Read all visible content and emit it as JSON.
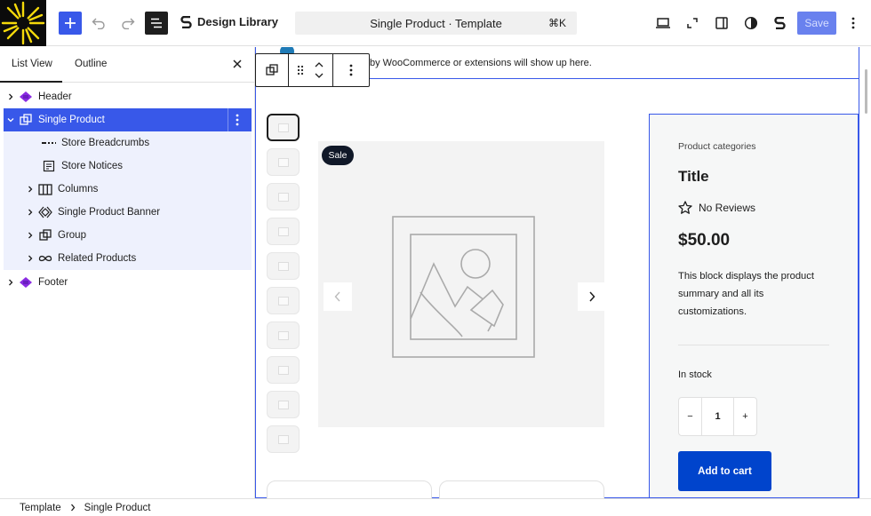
{
  "topbar": {
    "brand_label": "Design Library",
    "command_title": "Single Product · Template",
    "command_shortcut": "⌘K",
    "save_label": "Save"
  },
  "sidebar": {
    "tabs": [
      "List View",
      "Outline"
    ],
    "items": [
      {
        "label": "Header",
        "icon": "template-part-icon"
      },
      {
        "label": "Single Product",
        "icon": "group-icon"
      },
      {
        "label": "Store Breadcrumbs",
        "icon": "breadcrumbs-icon"
      },
      {
        "label": "Store Notices",
        "icon": "notices-icon"
      },
      {
        "label": "Columns",
        "icon": "columns-icon"
      },
      {
        "label": "Single Product Banner",
        "icon": "pattern-icon"
      },
      {
        "label": "Group",
        "icon": "group-icon"
      },
      {
        "label": "Related Products",
        "icon": "loop-icon"
      },
      {
        "label": "Footer",
        "icon": "template-part-icon"
      }
    ]
  },
  "canvas": {
    "notice_text": "by WooCommerce or extensions will show up here.",
    "sale_badge": "Sale",
    "product": {
      "category": "Product categories",
      "title": "Title",
      "reviews": "No Reviews",
      "price": "$50.00",
      "description": "This block displays the product summary and all its customizations.",
      "stock": "In stock",
      "quantity": "1",
      "qty_minus": "−",
      "qty_plus": "+",
      "cart_label": "Add to cart"
    }
  },
  "breadcrumb": [
    "Template",
    "Single Product"
  ],
  "colors": {
    "accent": "#3858e9",
    "cart_button": "#0044cc",
    "sale_badge": "#101828",
    "logo": "#f5d90a"
  }
}
